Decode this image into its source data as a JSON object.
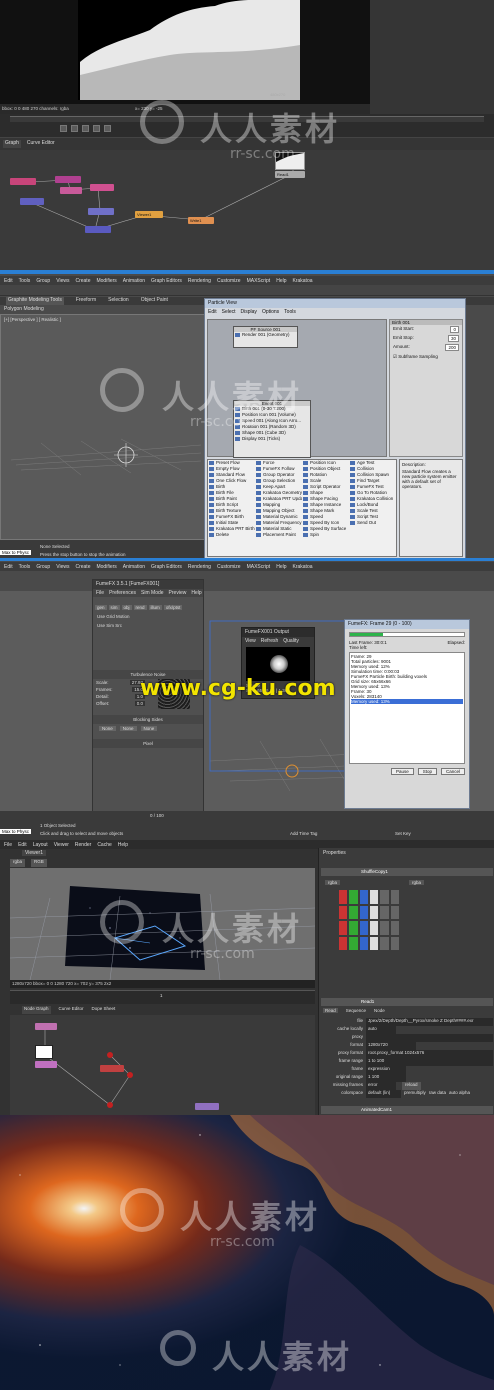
{
  "panel1": {
    "bbox_readout": "bbox: 0 0 480 270 channels: rgba",
    "coords_readout": "x= 230 y= -25",
    "viewer_res": "480x270",
    "tabs": [
      "Graph",
      "Curve Editor"
    ],
    "nodes": [
      "Read1",
      "Viewer1",
      "Write1"
    ]
  },
  "panel2": {
    "menu": [
      "Edit",
      "Tools",
      "Group",
      "Views",
      "Create",
      "Modifiers",
      "Animation",
      "Graph Editors",
      "Rendering",
      "Customize",
      "MAXScript",
      "Help",
      "Krakatoa"
    ],
    "ribbon_tabs": [
      "Graphite Modeling Tools",
      "Freeform",
      "Selection",
      "Object Paint"
    ],
    "ribbon_sub": "Polygon Modeling",
    "viewport_label": "[+] [Perspective ] [ Realistic ]",
    "status_selected": "None Selected",
    "status_hint": "Press the stop button to stop the animation",
    "maxscript_label": "Max to Physc",
    "particle_view": {
      "title": "Particle View",
      "menu": [
        "Edit",
        "Select",
        "Display",
        "Options",
        "Tools"
      ],
      "source_title": "PF Source 001",
      "source_item": "Render 001 (Geometry)",
      "event_title": "Event 001",
      "event_items": [
        "Birth 001 (0-30 T:200)",
        "Position Icon 001 (Volume)",
        "Speed 001 (Along Icon Arro...",
        "Rotation 001 (Random 3D)",
        "Shape 001 (Cube 3D)",
        "Display 001 (Ticks)"
      ],
      "depot_col1": [
        "Preset Flow",
        "Empty Flow",
        "Standard Flow",
        "One Click Flow",
        "Birth",
        "Birth File",
        "Birth Paint",
        "Birth Script",
        "Birth Texture",
        "FumeFX Birth",
        "Initial State",
        "Krakatoa PRT Birth",
        "Delete"
      ],
      "depot_col2": [
        "Force",
        "FumeFX Follow",
        "Group Operator",
        "Group Selection",
        "Keep Apart",
        "Krakatoa Geometry",
        "Krakatoa PRT Update",
        "Mapping",
        "Mapping Object",
        "Material Dynamic",
        "Material Frequency",
        "Material Static",
        "Placement Paint"
      ],
      "depot_col3": [
        "Position Icon",
        "Position Object",
        "Rotation",
        "Scale",
        "Script Operator",
        "Shape",
        "Shape Facing",
        "Shape Instance",
        "Shape Mark",
        "Speed",
        "Speed By Icon",
        "Speed By Surface",
        "Spin"
      ],
      "depot_col4": [
        "Age Test",
        "Collision",
        "Collision Spawn",
        "Find Target",
        "FumeFX Test",
        "Go To Rotation",
        "Krakatoa Collision",
        "Lock/Bond",
        "Scale Test",
        "Script Test",
        "Send Out"
      ],
      "description_label": "Description:",
      "description_text": "Standard Flow creates a new particle system emitter with a default set of operators.",
      "rollout_title": "Birth 001",
      "rollout_fields": [
        {
          "label": "Emit Start:",
          "value": "0"
        },
        {
          "label": "Emit Stop:",
          "value": "30"
        },
        {
          "label": "Amount:",
          "value": "200"
        }
      ],
      "subframe_label": "Subframe Sampling"
    }
  },
  "panel3": {
    "menu": [
      "Edit",
      "Tools",
      "Group",
      "Views",
      "Create",
      "Modifiers",
      "Animation",
      "Graph Editors",
      "Rendering",
      "Customize",
      "MAXScript",
      "Help",
      "Krakatoa"
    ],
    "fumefx_title": "FumeFX 3.5.1 [FumeFX001]",
    "fumefx_menu": [
      "File",
      "Preferences",
      "Sim Mode",
      "Preview",
      "Help"
    ],
    "fumefx_tabs": [
      "gen",
      "sim",
      "obj",
      "rend",
      "illum",
      "ofx/ptst"
    ],
    "fumefx_sections": [
      "Use Grid Motion",
      "Use Sim Src",
      "Turbulence Noise",
      "Blocking Sides",
      "Pixel"
    ],
    "fumefx_fields": [
      {
        "label": "Scale:",
        "value": "27.93"
      },
      {
        "label": "Frames:",
        "value": "15.0"
      },
      {
        "label": "Detail:",
        "value": "1.0"
      },
      {
        "label": "Offset:",
        "value": "0.0"
      }
    ],
    "blocking_none": [
      "None",
      "None",
      "None"
    ],
    "output_title": "FumeFX001 Output",
    "output_menu": [
      "View",
      "Refresh",
      "Quality"
    ],
    "output_mode": "Smoke",
    "output_size": "Size: 65,66,66 | 1.36",
    "sim_title": "FumeFX: Frame 29 (0 - 100)",
    "sim_last_frame": "Last Frame: 30:0:1",
    "sim_elapsed": "Elapsed:",
    "sim_eta": "Time left:",
    "sim_log": [
      "Frame: 29",
      "Total particles: 9001",
      "Memory used: 12%",
      "Simulation time: 0:00:03",
      "FumeFX Particle Birth: building voxels",
      "Grid size: 65x66x66",
      "Memory used: 13%",
      "Frame: 30",
      "Voxels: 283140",
      "Memory used: 13%"
    ],
    "sim_buttons": [
      "Pause",
      "Stop",
      "Cancel"
    ],
    "status_selected": "1 Object Selected",
    "status_hint": "Click and drag to select and move objects",
    "maxscript_label": "Max to Physc",
    "timeline_frame": "0 / 100",
    "add_time_tag": "Add Time Tag",
    "set_key": "Set Key"
  },
  "panel4": {
    "menu": [
      "File",
      "Edit",
      "Layout",
      "Viewer",
      "Render",
      "Cache",
      "Help"
    ],
    "viewer_tab": "Viewer1",
    "channel": "rgba",
    "channel2": "RGB",
    "format_readout": "1280x720 bbox= 0 0 1280 720  x= 702  y= 375  2x2",
    "res_label": "1280x720",
    "frame": "1",
    "graph_tabs": [
      "Node Graph",
      "Curve Editor",
      "Dope Sheet"
    ],
    "properties_title": "Properties",
    "shuffle_title": "ShuffleCopy1",
    "shuffle_in": "rgba",
    "shuffle_out": "rgba",
    "read_title": "Read1",
    "read_tabs": [
      "Read",
      "Sequence",
      "Node"
    ],
    "read_fields": [
      {
        "label": "file",
        "value": "Jpex/2/Depth/Depth__Pyrox/smoke Z Depth####.exr"
      },
      {
        "label": "cache locally",
        "value": "auto"
      },
      {
        "label": "proxy",
        "value": ""
      },
      {
        "label": "format",
        "value": "1280x720"
      },
      {
        "label": "proxy format",
        "value": "root.proxy_format 1024x576"
      },
      {
        "label": "frame range",
        "value": "1   to   100"
      },
      {
        "label": "frame",
        "value": "expression"
      },
      {
        "label": "original range",
        "value": "1   100"
      },
      {
        "label": "missing frames",
        "value": "error"
      },
      {
        "label": "colorspace",
        "value": "default (lin)"
      }
    ],
    "premultiplied": "premultiply",
    "raw_data": "raw data",
    "auto_alpha": "auto alpha",
    "reload": "reload",
    "bottom_node": "AnimatedCam1"
  },
  "watermarks": {
    "cn_text": "人人素材",
    "site": "rr-sc.com",
    "cgku": "www.cg-ku.com"
  }
}
